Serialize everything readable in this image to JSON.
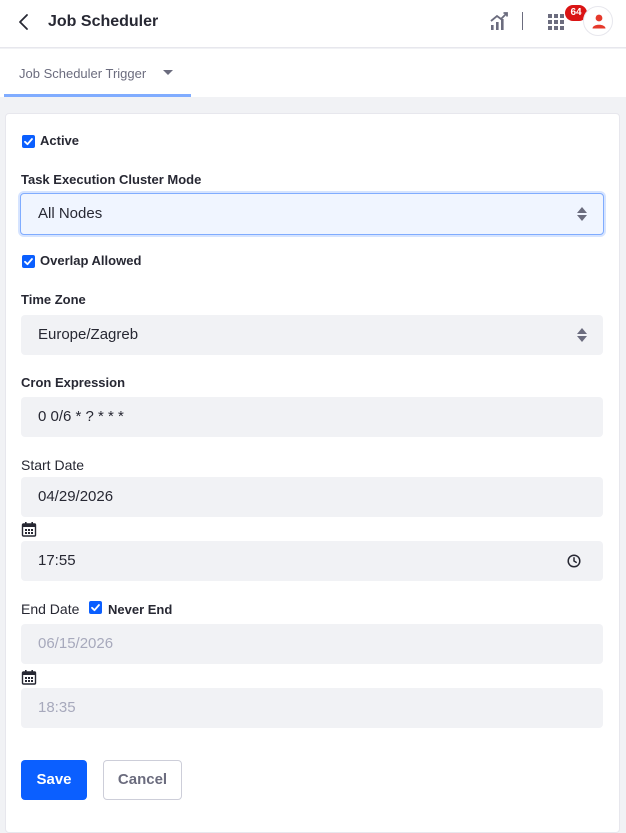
{
  "header": {
    "title": "Job Scheduler",
    "notification_count": "64"
  },
  "tabs": [
    {
      "label": "Job Scheduler Trigger"
    }
  ],
  "form": {
    "active_label": "Active",
    "active_checked": true,
    "cluster_mode_label": "Task Execution Cluster Mode",
    "cluster_mode_value": "All Nodes",
    "overlap_label": "Overlap Allowed",
    "overlap_checked": true,
    "timezone_label": "Time Zone",
    "timezone_value": "Europe/Zagreb",
    "cron_label": "Cron Expression",
    "cron_value": "0 0/6 * ? * * *",
    "start_date_label": "Start Date",
    "start_date_value": "04/29/2026",
    "start_time_value": "17:55",
    "end_date_label": "End Date",
    "never_end_label": "Never End",
    "never_end_checked": true,
    "end_date_value": "06/15/2026",
    "end_time_value": "18:35"
  },
  "actions": {
    "save_label": "Save",
    "cancel_label": "Cancel"
  },
  "colors": {
    "primary": "#0b5fff",
    "badge": "#da1414",
    "avatar_icon": "#e5392b",
    "tab_underline": "#80acff"
  },
  "icons": {
    "back": "chevron-left-icon",
    "analytics": "analytics-chart-icon",
    "apps": "apps-grid-icon",
    "user": "user-icon",
    "calendar": "calendar-icon",
    "clock": "clock-icon"
  }
}
